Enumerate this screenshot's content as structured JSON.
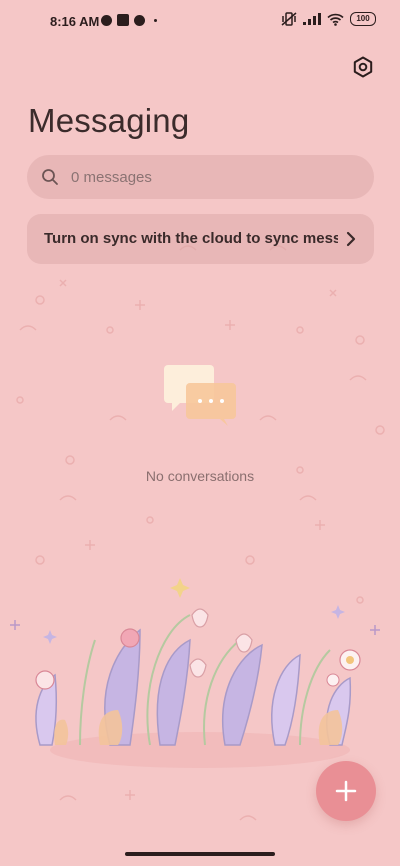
{
  "status_bar": {
    "time": "8:16 AM",
    "battery": "100"
  },
  "header": {
    "title": "Messaging",
    "settings_icon": "settings-hexagon-icon"
  },
  "search": {
    "placeholder": "0 messages",
    "icon": "search-icon"
  },
  "sync_banner": {
    "text": "Turn on sync with the cloud to sync messages",
    "icon": "chevron-right-icon"
  },
  "empty_state": {
    "text": "No conversations",
    "icon": "chat-bubbles-icon"
  },
  "fab": {
    "label": "+",
    "icon": "plus-icon"
  },
  "colors": {
    "background": "#f5c7c7",
    "accent": "#e98f95"
  }
}
